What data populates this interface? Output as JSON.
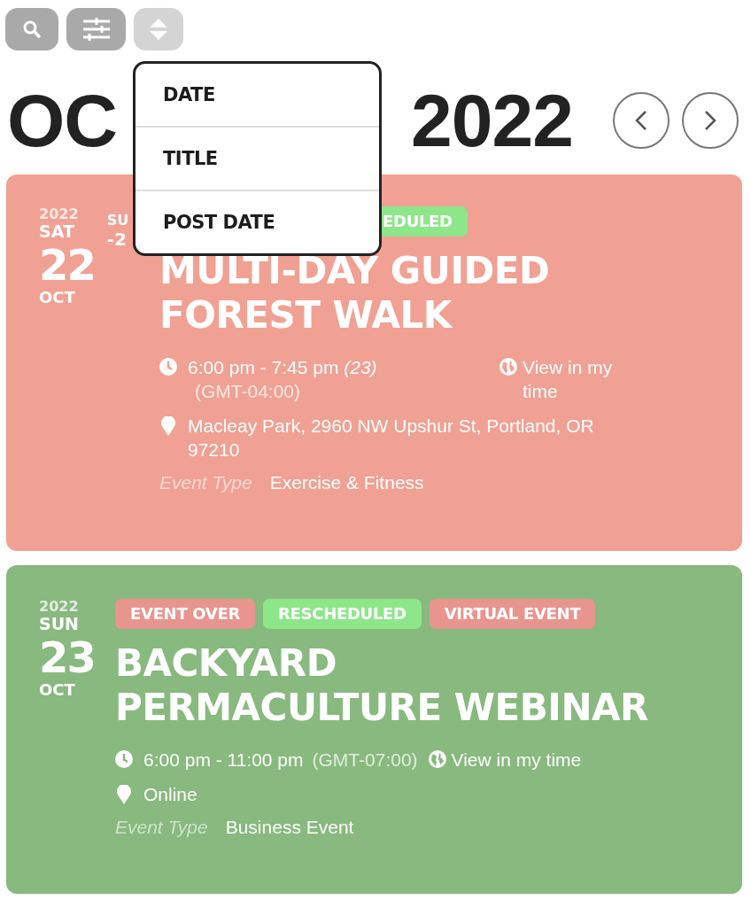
{
  "toolbar": {
    "buttons": [
      {
        "kind": "search",
        "expanded": false
      },
      {
        "kind": "filter",
        "expanded": false
      },
      {
        "kind": "sort",
        "expanded": true
      }
    ]
  },
  "sort_menu": {
    "options": [
      "DATE",
      "TITLE",
      "POST DATE"
    ]
  },
  "heading": {
    "visible_start": "OC",
    "visible_end": "2022"
  },
  "events": [
    {
      "color": "#f0a193",
      "year": "2022",
      "weekday": "SAT",
      "day": "22",
      "month": "OCT",
      "end": {
        "weekday": "SU",
        "day": "-2"
      },
      "tags": [
        {
          "label": "EDULED",
          "color": "#8ee68a"
        }
      ],
      "title": "MULTI-DAY GUIDED FOREST WALK",
      "time": "6:00 pm - 7:45 pm *(23)*",
      "timezone": "(GMT-04:00)",
      "view_link": "View in my time",
      "location": "Macleay Park, 2960 NW Upshur St, Portland, OR 97210",
      "type_label": "Event Type",
      "type": "Exercise & Fitness"
    },
    {
      "color": "#88b97e",
      "year": "2022",
      "weekday": "SUN",
      "day": "23",
      "month": "OCT",
      "tags": [
        {
          "label": "EVENT OVER",
          "color": "#e8958f"
        },
        {
          "label": "RESCHEDULED",
          "color": "#8ee68a"
        },
        {
          "label": "VIRTUAL EVENT",
          "color": "#e8958f"
        }
      ],
      "title": "BACKYARD PERMACULTURE WEBINAR",
      "time": "6:00 pm - 11:00 pm",
      "timezone": "(GMT-07:00)",
      "view_link": "View in my time",
      "location": "Online",
      "type_label": "Event Type",
      "type": "Business Event"
    }
  ]
}
